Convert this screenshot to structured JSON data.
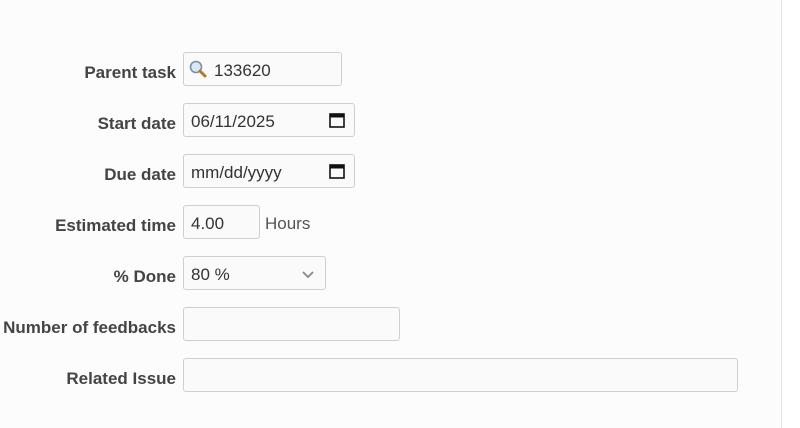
{
  "form": {
    "parent_task": {
      "label": "Parent task",
      "value": "133620",
      "icon": "search-icon"
    },
    "start_date": {
      "label": "Start date",
      "value": "06/11/2025",
      "icon": "calendar-icon"
    },
    "due_date": {
      "label": "Due date",
      "placeholder": "mm/dd/yyyy",
      "icon": "calendar-icon"
    },
    "estimated_time": {
      "label": "Estimated time",
      "value": "4.00",
      "unit": "Hours"
    },
    "done": {
      "label": "% Done",
      "value": "80 %",
      "icon": "chevron-down-icon"
    },
    "feedbacks": {
      "label": "Number of feedbacks",
      "value": ""
    },
    "related_issue": {
      "label": "Related Issue",
      "value": ""
    }
  }
}
